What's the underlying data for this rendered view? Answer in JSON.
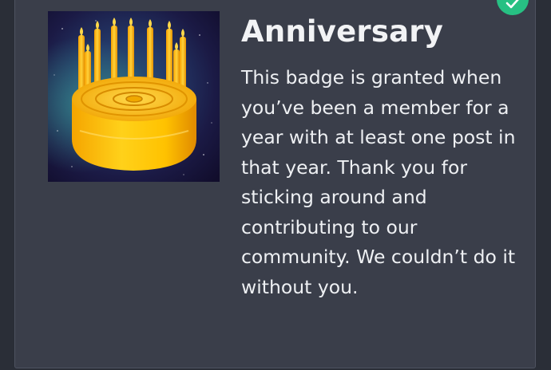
{
  "badge": {
    "title": "Anniversary",
    "description": "This badge is granted when you’ve been a member for a year with at least one post in that year. Thank you for sticking around and contributing to our community. We couldn’t do it without you.",
    "image_icon": "birthday-cake-with-candles",
    "granted": true,
    "granted_icon": "check-icon"
  },
  "colors": {
    "page_background": "#2a2e37",
    "card_background": "#3a3e4a",
    "card_border": "#4d5260",
    "text_primary": "#f2f3f5",
    "granted_accent": "#27c083",
    "cake_gold": "#ffb400",
    "image_background": "#1d1740"
  }
}
